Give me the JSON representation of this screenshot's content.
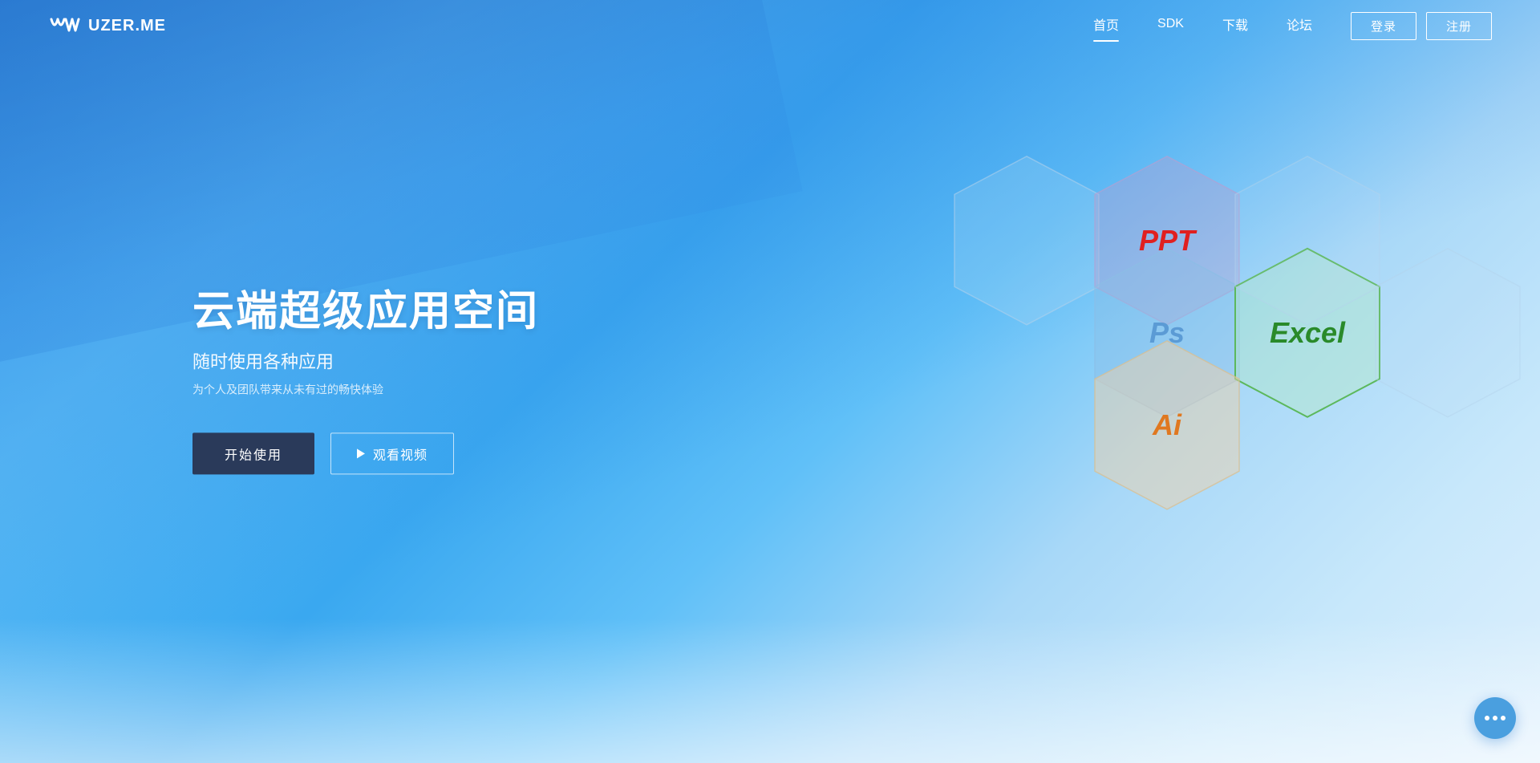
{
  "nav": {
    "logo_text": "UZER.ME",
    "links": [
      {
        "label": "首页",
        "active": true
      },
      {
        "label": "SDK",
        "active": false
      },
      {
        "label": "下载",
        "active": false
      },
      {
        "label": "论坛",
        "active": false
      }
    ],
    "btn_login": "登录",
    "btn_register": "注册"
  },
  "hero": {
    "title": "云端超级应用空间",
    "subtitle": "随时使用各种应用",
    "desc": "为个人及团队带来从未有过的畅快体验",
    "btn_start": "开始使用",
    "btn_video": "观看视频"
  },
  "hexagons": [
    {
      "id": "ppt",
      "label": "PPT",
      "color": "#e02020",
      "fill": "rgba(180,160,200,0.35)",
      "stroke": "rgba(180,160,200,0.6)"
    },
    {
      "id": "ps",
      "label": "Ps",
      "color": "#5b9bd5",
      "fill": "rgba(140,190,230,0.35)",
      "stroke": "rgba(140,190,230,0.7)"
    },
    {
      "id": "excel",
      "label": "Excel",
      "color": "#2a8a2a",
      "fill": "rgba(180,230,190,0.35)",
      "stroke": "#5cb85c"
    },
    {
      "id": "ai",
      "label": "Ai",
      "color": "#e07820",
      "fill": "rgba(240,210,170,0.45)",
      "stroke": "rgba(220,190,140,0.7)"
    },
    {
      "id": "outline-tl",
      "label": "",
      "color": "transparent",
      "fill": "rgba(200,225,245,0.18)",
      "stroke": "rgba(180,210,235,0.55)"
    },
    {
      "id": "outline-tr",
      "label": "",
      "color": "transparent",
      "fill": "rgba(200,225,245,0.12)",
      "stroke": "rgba(180,210,235,0.45)"
    },
    {
      "id": "outline-br",
      "label": "",
      "color": "transparent",
      "fill": "rgba(200,225,245,0.12)",
      "stroke": "rgba(180,210,235,0.45)"
    }
  ]
}
